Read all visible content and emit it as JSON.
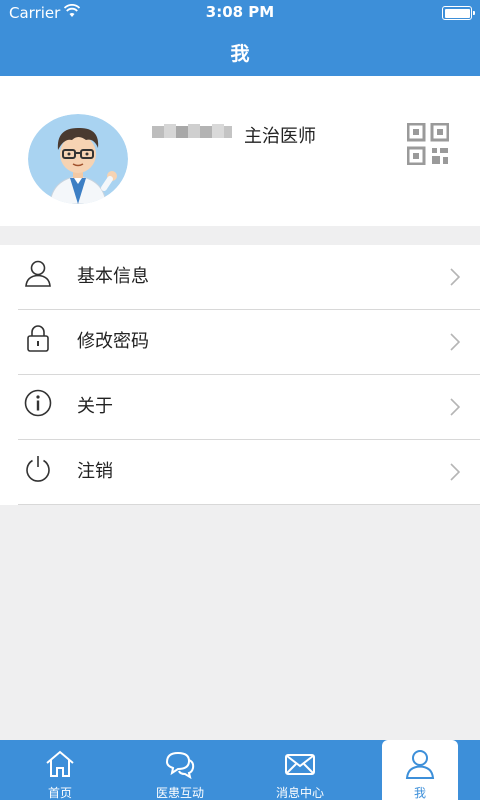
{
  "status_bar": {
    "carrier": "Carrier",
    "time": "3:08 PM"
  },
  "nav": {
    "title": "我"
  },
  "profile": {
    "doctor_title": "主治医师"
  },
  "menu": [
    {
      "label": "基本信息",
      "icon": "user-icon"
    },
    {
      "label": "修改密码",
      "icon": "lock-icon"
    },
    {
      "label": "关于",
      "icon": "info-icon"
    },
    {
      "label": "注销",
      "icon": "power-icon"
    }
  ],
  "tabs": [
    {
      "label": "首页",
      "icon": "home-icon"
    },
    {
      "label": "医患互动",
      "icon": "chat-icon"
    },
    {
      "label": "消息中心",
      "icon": "mail-icon"
    },
    {
      "label": "我",
      "icon": "person-icon",
      "active": true
    }
  ],
  "colors": {
    "brand": "#3d8fd9",
    "background": "#efeff0"
  }
}
